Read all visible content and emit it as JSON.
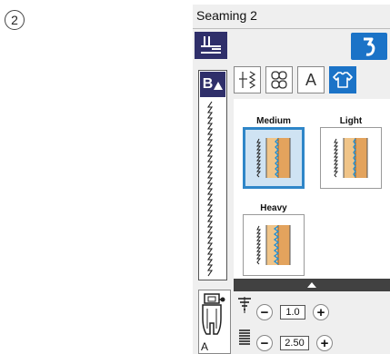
{
  "step_marker": "2",
  "screen_title": "Seaming 2",
  "bset_label": "B",
  "tab_letter": "A",
  "options": [
    {
      "label": "Medium",
      "selected": true
    },
    {
      "label": "Light",
      "selected": false
    },
    {
      "label": "Heavy",
      "selected": false
    }
  ],
  "presser_foot": "A",
  "width_value": "1.0",
  "length_value": "2.50",
  "colors": {
    "accent": "#1b73c7",
    "dark": "#2f2f6a",
    "selection": "#2f86c8"
  }
}
